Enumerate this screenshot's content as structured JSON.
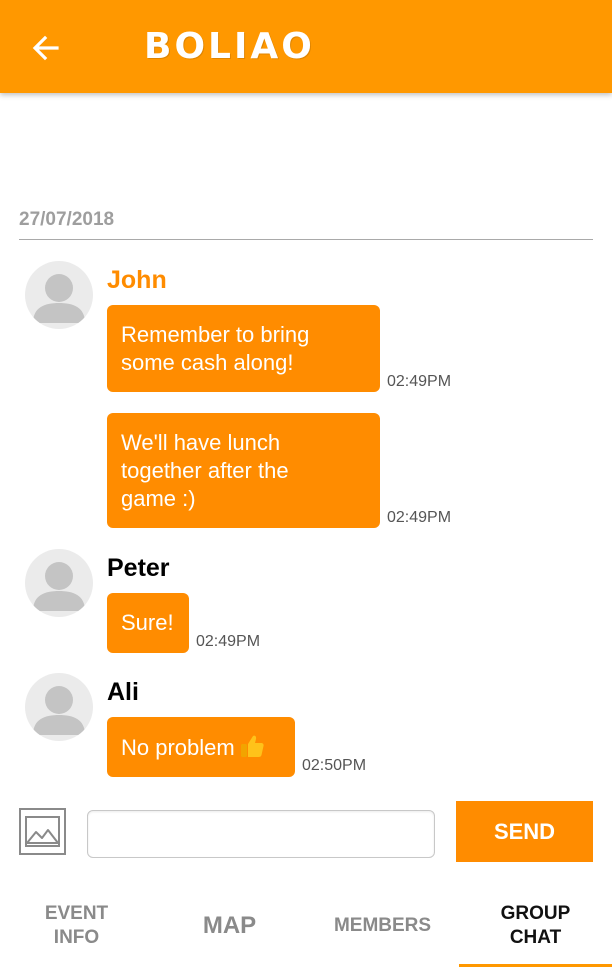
{
  "app": {
    "title": "BOLIAO",
    "back_icon": "arrow-left-icon"
  },
  "chat": {
    "date": "27/07/2018",
    "messages": [
      {
        "sender": "John",
        "text": "Remember to bring\nsome cash along!",
        "time": "02:49PM"
      },
      {
        "sender": "",
        "text": "We'll have lunch\ntogether after the\ngame :)",
        "time": "02:49PM"
      },
      {
        "sender": "Peter",
        "text": "Sure!",
        "time": "02:49PM"
      },
      {
        "sender": "Ali",
        "text": "No problem",
        "emoji": "thumbs-up-icon",
        "time": "02:50PM"
      }
    ]
  },
  "composer": {
    "image_icon": "image-icon",
    "placeholder": "",
    "value": "",
    "send_label": "SEND"
  },
  "tabs": [
    {
      "label": "EVENT\nINFO",
      "active": false
    },
    {
      "label": "MAP",
      "active": false
    },
    {
      "label": "MEMBERS",
      "active": false
    },
    {
      "label": "GROUP\nCHAT",
      "active": true
    }
  ],
  "colors": {
    "primary": "#ff9800",
    "bubble": "#ff8c00",
    "own_name": "#ff8c00",
    "timestamp": "#555555",
    "inactive_tab": "#8a8a8a"
  }
}
